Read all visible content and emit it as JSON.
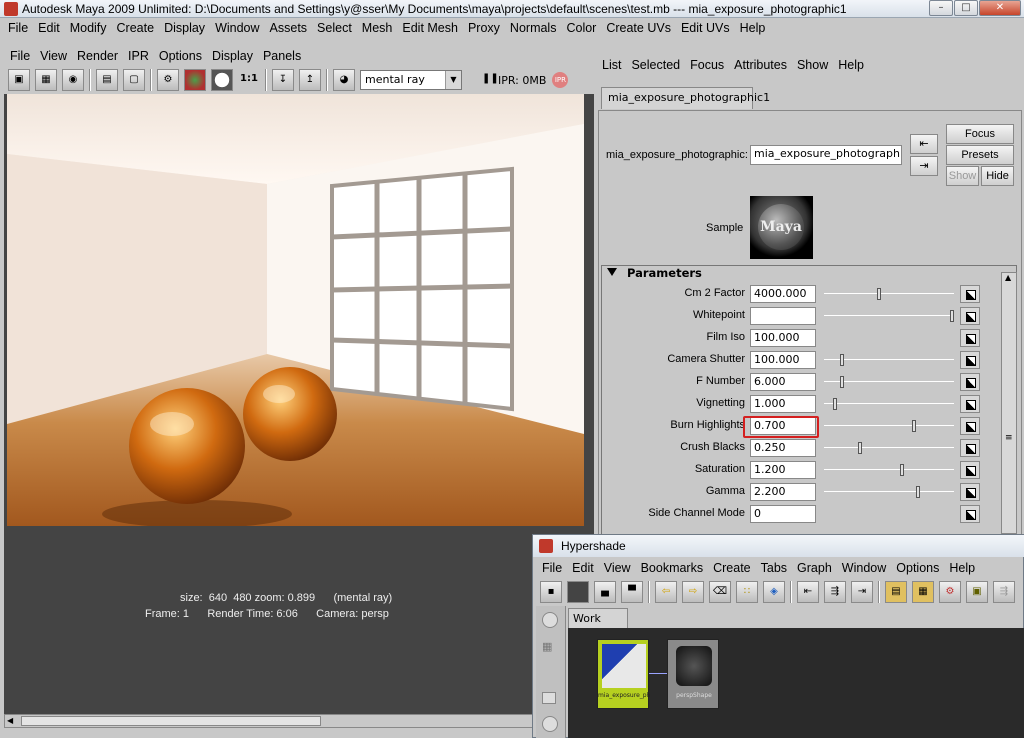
{
  "window": {
    "title": "Autodesk Maya 2009 Unlimited: D:\\Documents and Settings\\y@sser\\My Documents\\maya\\projects\\default\\scenes\\test.mb   ---   mia_exposure_photographic1"
  },
  "main_menu": [
    "File",
    "Edit",
    "Modify",
    "Create",
    "Display",
    "Window",
    "Assets",
    "Select",
    "Mesh",
    "Edit Mesh",
    "Proxy",
    "Normals",
    "Color",
    "Create UVs",
    "Edit UVs",
    "Help"
  ],
  "render_view": {
    "menu": [
      "File",
      "View",
      "Render",
      "IPR",
      "Options",
      "Display",
      "Panels"
    ],
    "ratio_label": "1:1",
    "renderer": "mental ray",
    "ipr_status": "IPR: 0MB",
    "ipr_badge": "IPR",
    "info_line1": "size:  640  480 zoom: 0.899      (mental ray)",
    "info_line2": "Frame: 1      Render Time: 6:06      Camera: persp"
  },
  "attribute_editor": {
    "menu": [
      "List",
      "Selected",
      "Focus",
      "Attributes",
      "Show",
      "Help"
    ],
    "tab": "mia_exposure_photographic1",
    "node_label": "mia_exposure_photographic:",
    "node_value": "mia_exposure_photographic1",
    "buttons": {
      "focus": "Focus",
      "presets": "Presets",
      "show": "Show",
      "hide": "Hide"
    },
    "sample_label": "Sample",
    "sample_logo": "Maya",
    "section": "Parameters",
    "params": [
      {
        "label": "Cm 2 Factor",
        "value": "4000.000",
        "slider": 0.42,
        "has_field": true,
        "has_slider": true
      },
      {
        "label": "Whitepoint",
        "value": "",
        "slider": 1.0,
        "has_field": false,
        "has_slider": true
      },
      {
        "label": "Film Iso",
        "value": "100.000",
        "slider": null,
        "has_field": true,
        "has_slider": false
      },
      {
        "label": "Camera Shutter",
        "value": "100.000",
        "slider": 0.13,
        "has_field": true,
        "has_slider": true
      },
      {
        "label": "F Number",
        "value": "6.000",
        "slider": 0.13,
        "has_field": true,
        "has_slider": true
      },
      {
        "label": "Vignetting",
        "value": "1.000",
        "slider": 0.07,
        "has_field": true,
        "has_slider": true
      },
      {
        "label": "Burn Highlights",
        "value": "0.700",
        "slider": 0.7,
        "has_field": true,
        "has_slider": true
      },
      {
        "label": "Crush Blacks",
        "value": "0.250",
        "slider": 0.27,
        "has_field": true,
        "has_slider": true
      },
      {
        "label": "Saturation",
        "value": "1.200",
        "slider": 0.6,
        "has_field": true,
        "has_slider": true
      },
      {
        "label": "Gamma",
        "value": "2.200",
        "slider": 0.73,
        "has_field": true,
        "has_slider": true
      },
      {
        "label": "Side Channel Mode",
        "value": "0",
        "slider": null,
        "has_field": true,
        "has_slider": false
      }
    ]
  },
  "hypershade": {
    "title": "Hypershade",
    "menu": [
      "File",
      "Edit",
      "View",
      "Bookmarks",
      "Create",
      "Tabs",
      "Graph",
      "Window",
      "Options",
      "Help"
    ],
    "work_tab": "Work Area",
    "nodes": [
      "mia_exposure_phot...",
      "perspShape"
    ]
  }
}
